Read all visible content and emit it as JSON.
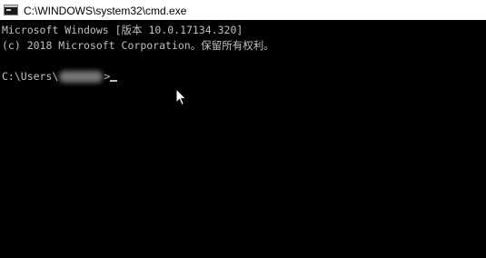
{
  "window": {
    "title": "C:\\WINDOWS\\system32\\cmd.exe",
    "icon": "cmd-icon"
  },
  "console": {
    "line1": "Microsoft Windows [版本 10.0.17134.320]",
    "line2": "(c) 2018 Microsoft Corporation。保留所有权利。",
    "prompt_prefix": "C:\\Users\\",
    "prompt_suffix": ">"
  },
  "cursor": {
    "icon": "mouse-pointer-icon"
  },
  "colors": {
    "background": "#000000",
    "text": "#c0c0c0",
    "titlebar": "#ffffff"
  }
}
